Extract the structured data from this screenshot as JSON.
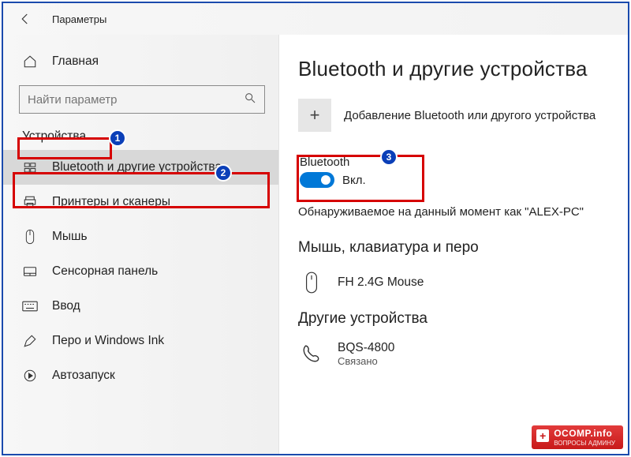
{
  "window": {
    "title": "Параметры"
  },
  "sidebar": {
    "home_label": "Главная",
    "search_placeholder": "Найти параметр",
    "section_label": "Устройства",
    "items": [
      {
        "label": "Bluetooth и другие устройства",
        "icon": "bluetooth-devices"
      },
      {
        "label": "Принтеры и сканеры",
        "icon": "printer"
      },
      {
        "label": "Мышь",
        "icon": "mouse"
      },
      {
        "label": "Сенсорная панель",
        "icon": "touchpad"
      },
      {
        "label": "Ввод",
        "icon": "keyboard"
      },
      {
        "label": "Перо и Windows Ink",
        "icon": "pen"
      },
      {
        "label": "Автозапуск",
        "icon": "autoplay"
      }
    ]
  },
  "main": {
    "title": "Bluetooth и другие устройства",
    "add_label": "Добавление Bluetooth или другого устройства",
    "bluetooth": {
      "label": "Bluetooth",
      "state_label": "Вкл.",
      "on": true
    },
    "discoverable_text": "Обнаруживаемое на данный момент как \"ALEX-PC\"",
    "section_mouse": "Мышь, клавиатура и перо",
    "device_mouse": {
      "name": "FH 2.4G Mouse"
    },
    "section_other": "Другие устройства",
    "device_other": {
      "name": "BQS-4800",
      "status": "Связано"
    }
  },
  "annotations": {
    "badge1": "1",
    "badge2": "2",
    "badge3": "3"
  },
  "watermark": {
    "line1": "OCOMP.info",
    "line2": "ВОПРОСЫ АДМИНУ"
  }
}
